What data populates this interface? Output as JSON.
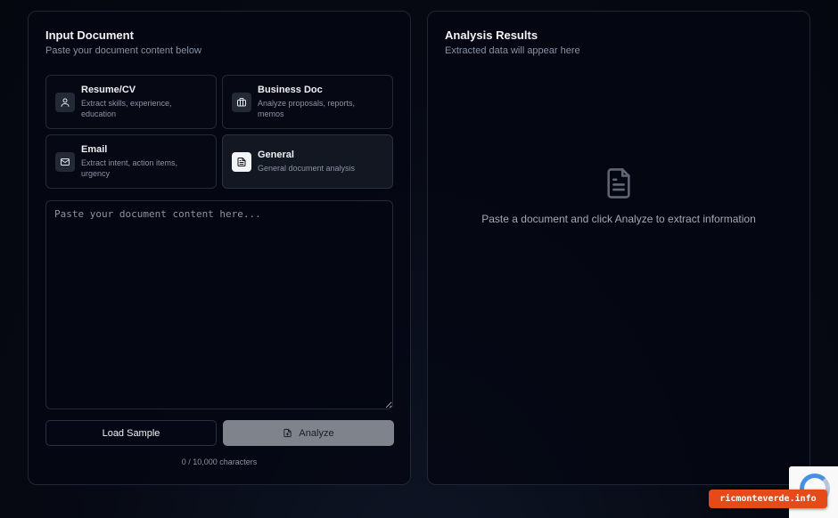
{
  "input_panel": {
    "title": "Input Document",
    "subtitle": "Paste your document content below",
    "types": [
      {
        "title": "Resume/CV",
        "desc": "Extract skills, experience, education",
        "icon": "user-icon",
        "active": false
      },
      {
        "title": "Business Doc",
        "desc": "Analyze proposals, reports, memos",
        "icon": "briefcase-icon",
        "active": false
      },
      {
        "title": "Email",
        "desc": "Extract intent, action items, urgency",
        "icon": "mail-icon",
        "active": false
      },
      {
        "title": "General",
        "desc": "General document analysis",
        "icon": "file-text-icon",
        "active": true
      }
    ],
    "textarea_placeholder": "Paste your document content here...",
    "textarea_value": "",
    "load_sample_label": "Load Sample",
    "analyze_label": "Analyze",
    "char_count": "0 / 10,000 characters"
  },
  "results_panel": {
    "title": "Analysis Results",
    "subtitle": "Extracted data will appear here",
    "empty_message": "Paste a document and click Analyze to extract information",
    "empty_icon": "file-text-icon"
  },
  "watermark": "ricmonteverde.info",
  "colors": {
    "background": "#070b16",
    "panel_border": "#1f2635",
    "analyze_disabled": "#7f838c",
    "watermark_bg": "#e64a19"
  }
}
